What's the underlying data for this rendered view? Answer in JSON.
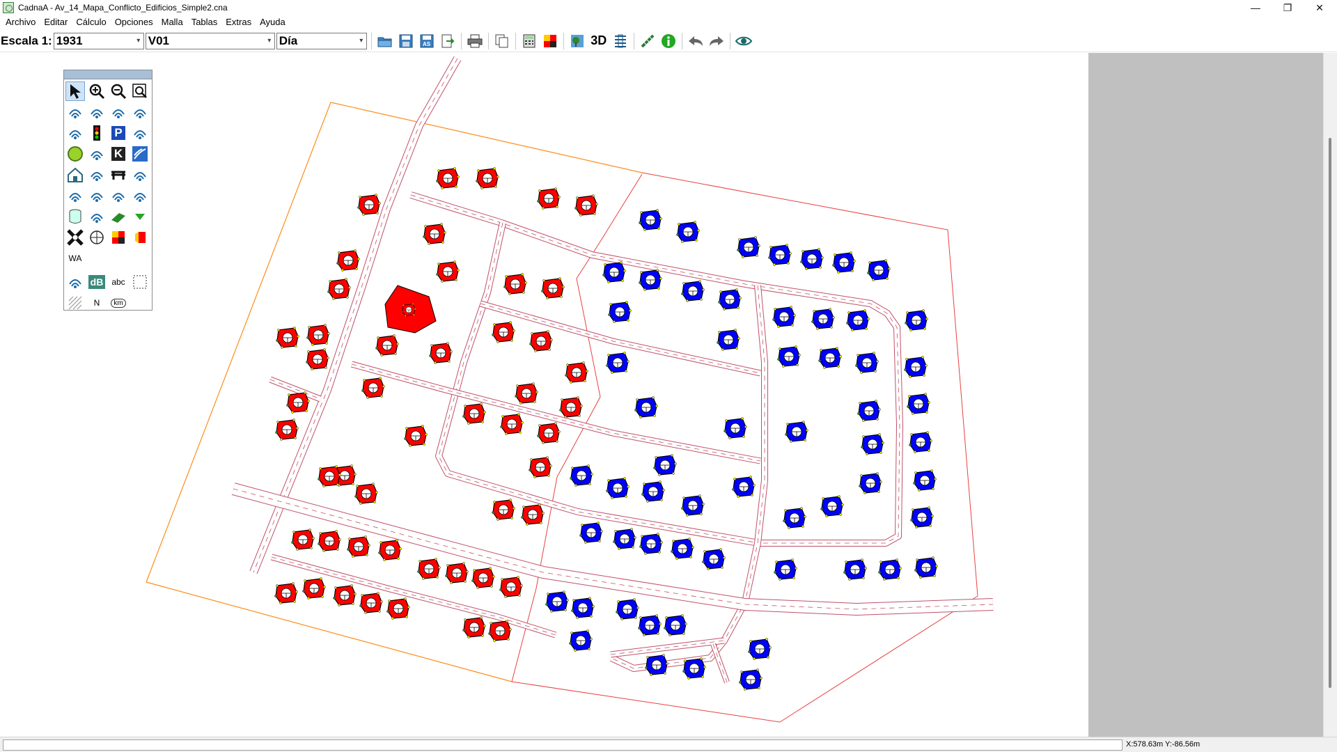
{
  "window": {
    "title": "CadnaA - Av_14_Mapa_Conflicto_Edificios_Simple2.cna",
    "minimize_glyph": "—",
    "restore_glyph": "❐",
    "close_glyph": "✕"
  },
  "menu": {
    "items": [
      "Archivo",
      "Editar",
      "Cálculo",
      "Opciones",
      "Malla",
      "Tablas",
      "Extras",
      "Ayuda"
    ]
  },
  "toolbar": {
    "scale_label": "Escala 1:",
    "scale_value": "1931",
    "variant_value": "V01",
    "period_value": "Día",
    "three_d_label": "3D",
    "icons": [
      "open-folder-icon",
      "save-icon",
      "save-as-icon",
      "export-icon",
      "print-icon",
      "copy-icon",
      "calculator-icon",
      "grid-map-icon",
      "tree-icon",
      "table-icon",
      "ruler-icon",
      "info-icon",
      "undo-icon",
      "redo-icon",
      "eye-icon"
    ]
  },
  "palette": {
    "tools": [
      "select-arrow-icon",
      "zoom-in-icon",
      "zoom-out-icon",
      "zoom-extent-icon",
      "point-source-icon",
      "line-source-icon",
      "area-source-icon",
      "radiator-icon",
      "road-icon",
      "traffic-light-icon",
      "parking-icon",
      "railway-icon",
      "industrial-icon",
      "airfield-icon",
      "k-icon",
      "wave-icon",
      "building-icon",
      "barrier-icon",
      "bridge-icon",
      "terrain-icon",
      "contour-icon",
      "forest-icon",
      "zone-icon",
      "embankment-icon",
      "cylinder-icon",
      "3d-reflector-icon",
      "ground-icon",
      "arrow-down-icon",
      "receiver-icon",
      "grid-receiver-icon",
      "facade-icon",
      "facade-point-icon",
      "wa-icon",
      "tree-calc-icon",
      "db-label-icon",
      "text-icon",
      "selection-box-icon",
      "hatch-icon",
      "north-arrow-icon",
      "km-icon"
    ],
    "db_label": "dB",
    "text_label": "abc",
    "wa_label": "WA",
    "north_label": "N",
    "km_label": "km",
    "k_label": "K",
    "p_label": "P"
  },
  "map": {
    "red_building_color": "#ff0000",
    "blue_building_color": "#0000ff",
    "road_color": "#c0506a",
    "area_boundary_color": "#ff8c1a",
    "zone_line_color": "#e84040"
  },
  "status": {
    "coordinates": "X:578.63m Y:-86.56m"
  }
}
